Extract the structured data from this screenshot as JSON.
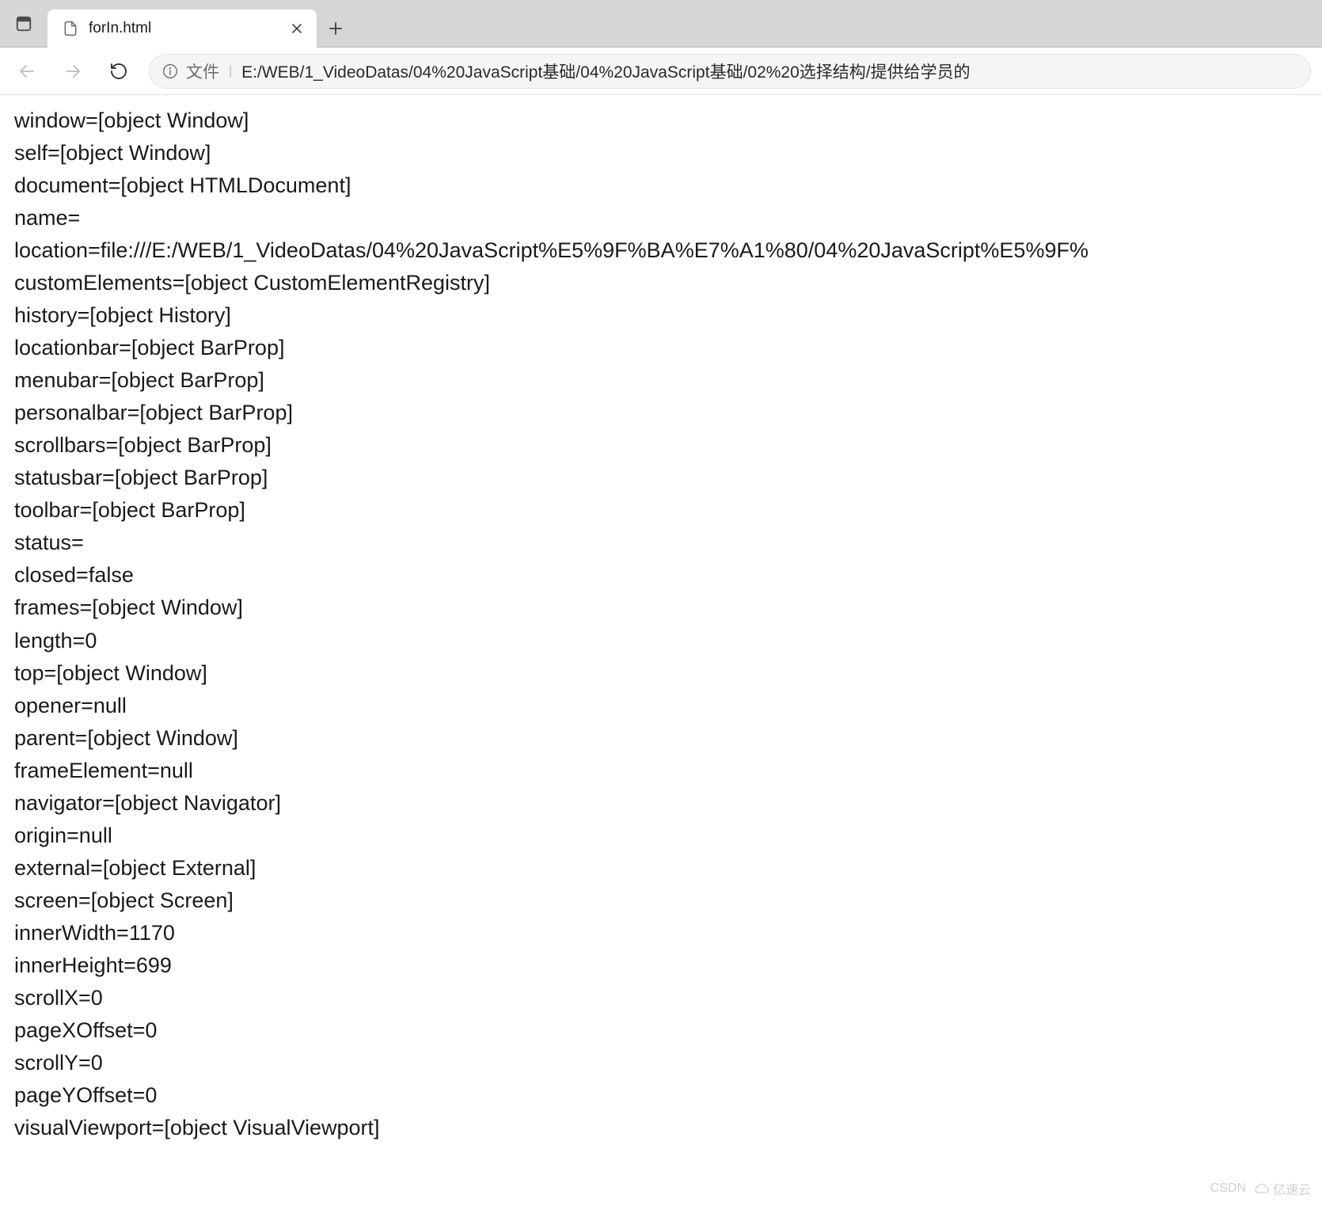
{
  "tab": {
    "title": "forIn.html"
  },
  "addressbar": {
    "source_label": "文件",
    "url": "E:/WEB/1_VideoDatas/04%20JavaScript基础/04%20JavaScript基础/02%20选择结构/提供给学员的"
  },
  "content": {
    "lines": [
      "window=[object Window]",
      "self=[object Window]",
      "document=[object HTMLDocument]",
      "name=",
      "location=file:///E:/WEB/1_VideoDatas/04%20JavaScript%E5%9F%BA%E7%A1%80/04%20JavaScript%E5%9F%",
      "customElements=[object CustomElementRegistry]",
      "history=[object History]",
      "locationbar=[object BarProp]",
      "menubar=[object BarProp]",
      "personalbar=[object BarProp]",
      "scrollbars=[object BarProp]",
      "statusbar=[object BarProp]",
      "toolbar=[object BarProp]",
      "status=",
      "closed=false",
      "frames=[object Window]",
      "length=0",
      "top=[object Window]",
      "opener=null",
      "parent=[object Window]",
      "frameElement=null",
      "navigator=[object Navigator]",
      "origin=null",
      "external=[object External]",
      "screen=[object Screen]",
      "innerWidth=1170",
      "innerHeight=699",
      "scrollX=0",
      "pageXOffset=0",
      "scrollY=0",
      "pageYOffset=0",
      "visualViewport=[object VisualViewport]"
    ]
  },
  "watermark": {
    "csdn": "CSDN",
    "yiyun": "亿速云"
  }
}
